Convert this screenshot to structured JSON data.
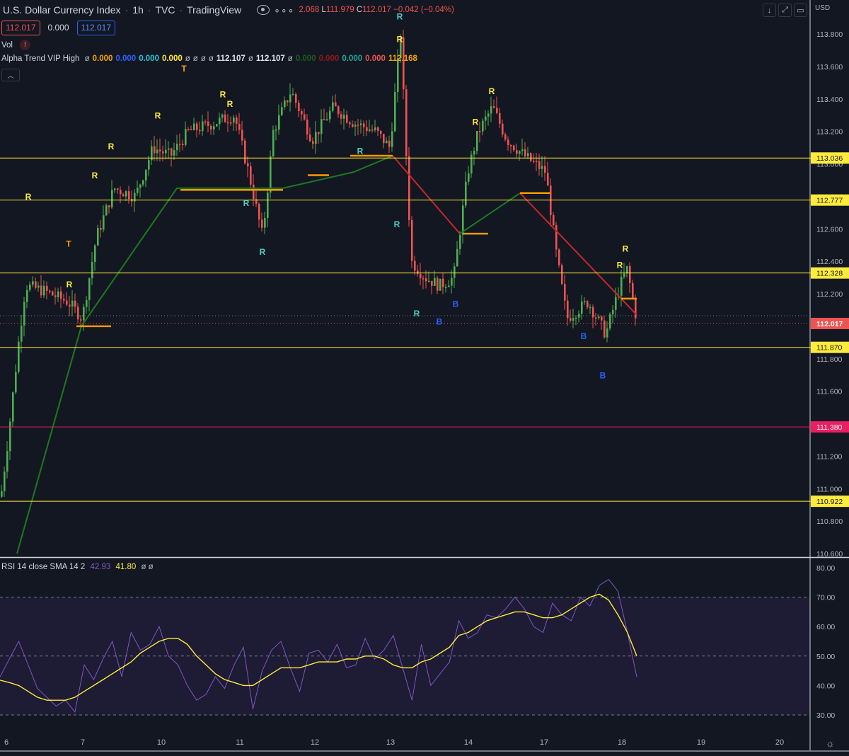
{
  "header": {
    "symbol": "U.S. Dollar Currency Index",
    "interval": "1h",
    "exchange": "TVC",
    "source": "TradingView",
    "more_icon": "more-icon",
    "ohlc": {
      "h_frag": "2.068",
      "l_label": "L",
      "l_value": "111.979",
      "c_label": "C",
      "c_value": "112.017",
      "change": "−0.042 (−0.04%)"
    }
  },
  "price_boxes": {
    "bid": "112.017",
    "spread": "0.000",
    "ask": "112.017"
  },
  "volume_label": "Vol",
  "alpha_trend": {
    "name": "Alpha Trend VIP High",
    "values": [
      {
        "t": "ø",
        "c": "#b2b5be"
      },
      {
        "t": "0.000",
        "c": "#f7a600"
      },
      {
        "t": "0.000",
        "c": "#2962ff"
      },
      {
        "t": "0.000",
        "c": "#26c6da"
      },
      {
        "t": "0.000",
        "c": "#ffeb3b"
      },
      {
        "t": "ø",
        "c": "#b2b5be"
      },
      {
        "t": "ø",
        "c": "#b2b5be"
      },
      {
        "t": "ø",
        "c": "#b2b5be"
      },
      {
        "t": "ø",
        "c": "#b2b5be"
      },
      {
        "t": "112.107",
        "c": "#e0e3eb"
      },
      {
        "t": "ø",
        "c": "#b2b5be"
      },
      {
        "t": "112.107",
        "c": "#e0e3eb"
      },
      {
        "t": "ø",
        "c": "#b2b5be"
      },
      {
        "t": "0.000",
        "c": "#1b5e20"
      },
      {
        "t": "0.000",
        "c": "#8b1a1a"
      },
      {
        "t": "0.000",
        "c": "#26a69a"
      },
      {
        "t": "0.000",
        "c": "#ef5350"
      },
      {
        "t": "112.168",
        "c": "#f7a600"
      }
    ]
  },
  "rsi": {
    "label": "RSI 14 close SMA 14 2",
    "rsi_value": "42.93",
    "sma_value": "41.80",
    "extra": "ø ø"
  },
  "price_axis": {
    "currency": "USD",
    "ticks": [
      "113.800",
      "113.600",
      "113.400",
      "113.200",
      "113.000",
      "112.800",
      "112.600",
      "112.400",
      "112.200",
      "112.000",
      "111.800",
      "111.600",
      "111.400",
      "111.200",
      "111.000",
      "110.800",
      "110.600"
    ],
    "hidden_ticks": [
      "113.000",
      "112.800",
      "111.400"
    ],
    "levels": [
      {
        "label": "113.036",
        "price": 113.036,
        "color": "#ffeb3b"
      },
      {
        "label": "112.777",
        "price": 112.777,
        "color": "#ffeb3b"
      },
      {
        "label": "112.328",
        "price": 112.328,
        "color": "#ffeb3b"
      },
      {
        "label": "111.870",
        "price": 111.87,
        "color": "#ffeb3b"
      },
      {
        "label": "111.380",
        "price": 111.38,
        "color": "#e91e63"
      },
      {
        "label": "110.922",
        "price": 110.922,
        "color": "#ffeb3b"
      }
    ],
    "current": {
      "label": "112.017",
      "price": 112.017,
      "color": "#ef5350"
    }
  },
  "rsi_axis": {
    "ticks": [
      "80.00",
      "70.00",
      "60.00",
      "50.00",
      "40.00",
      "30.00"
    ],
    "bands": [
      70,
      50,
      30
    ]
  },
  "time_axis": {
    "labels": [
      "6",
      "7",
      "10",
      "11",
      "12",
      "13",
      "14",
      "17",
      "18",
      "19",
      "20"
    ]
  },
  "signals": [
    {
      "t": "R",
      "c": "#ffeb3b",
      "p": 113.75
    },
    {
      "t": "T",
      "c": "#f7a600",
      "p": 113.57
    },
    {
      "t": "R",
      "c": "#ffeb3b",
      "p": 113.41
    },
    {
      "t": "R",
      "c": "#ffeb3b",
      "p": 113.35
    },
    {
      "t": "R",
      "c": "#ffeb3b",
      "p": 113.28
    },
    {
      "t": "R",
      "c": "#ffeb3b",
      "p": 113.09
    },
    {
      "t": "R",
      "c": "#ffeb3b",
      "p": 112.91
    },
    {
      "t": "R",
      "c": "#ffeb3b",
      "p": 112.78
    },
    {
      "t": "T",
      "c": "#f7a600",
      "p": 112.49
    },
    {
      "t": "R",
      "c": "#ffeb3b",
      "p": 112.24
    },
    {
      "t": "R",
      "c": "#4dd0c7",
      "p": 112.74
    },
    {
      "t": "R",
      "c": "#4dd0c7",
      "p": 112.44
    },
    {
      "t": "R",
      "c": "#4dd0c7",
      "p": 113.06
    },
    {
      "t": "R",
      "c": "#4dd0c7",
      "p": 113.89
    },
    {
      "t": "R",
      "c": "#4dd0c7",
      "p": 112.61
    },
    {
      "t": "R",
      "c": "#4dd0c7",
      "p": 112.06
    },
    {
      "t": "B",
      "c": "#2962ff",
      "p": 112.01
    },
    {
      "t": "B",
      "c": "#2962ff",
      "p": 112.12
    },
    {
      "t": "R",
      "c": "#ffeb3b",
      "p": 113.43
    },
    {
      "t": "R",
      "c": "#ffeb3b",
      "p": 113.24
    },
    {
      "t": "B",
      "c": "#2962ff",
      "p": 111.92
    },
    {
      "t": "B",
      "c": "#2962ff",
      "p": 111.68
    },
    {
      "t": "R",
      "c": "#ffeb3b",
      "p": 112.46
    },
    {
      "t": "R",
      "c": "#ffeb3b",
      "p": 112.36
    }
  ],
  "chart_data": {
    "type": "line",
    "price_range": [
      110.6,
      113.9
    ],
    "rsi_range": [
      27,
      82
    ],
    "trend_line": {
      "x": [
        "6",
        "7",
        "10",
        "11",
        "12",
        "13",
        "14",
        "17",
        "18"
      ],
      "values": [
        110.6,
        112.0,
        112.85,
        112.85,
        112.95,
        113.05,
        112.57,
        112.82,
        112.07
      ]
    },
    "rsi_series": [
      {
        "name": "RSI",
        "color": "#7e57c2",
        "values": [
          42.9,
          58,
          72,
          76,
          74,
          67,
          70,
          62,
          64,
          68,
          58,
          60,
          66,
          70,
          66,
          63,
          64,
          58,
          56,
          62,
          48,
          44,
          40,
          54,
          35,
          46,
          57,
          52,
          49,
          56,
          47,
          46,
          54,
          48,
          52,
          51,
          38,
          46,
          55,
          52,
          45,
          32,
          53,
          47,
          39,
          43,
          37,
          35,
          40,
          47,
          50,
          60,
          54,
          52,
          58,
          43,
          55,
          49,
          42,
          47,
          31,
          35,
          33,
          36,
          39,
          47,
          55,
          49,
          42.93
        ]
      },
      {
        "name": "SMA",
        "color": "#ffeb3b",
        "values": [
          50,
          58,
          64,
          69,
          71,
          70,
          68,
          66,
          64,
          63,
          63,
          64,
          65,
          65,
          64,
          63,
          62,
          60,
          58,
          57,
          53,
          51,
          49,
          48,
          46,
          46,
          47,
          49,
          50,
          50,
          49,
          49,
          48,
          48,
          48,
          47,
          46,
          46,
          46,
          44,
          42,
          40,
          40,
          41,
          42,
          44,
          47,
          50,
          54,
          56,
          56,
          55,
          53,
          51,
          48,
          46,
          44,
          42,
          40,
          38,
          36,
          35,
          35,
          35,
          36,
          38,
          40,
          41,
          41.8
        ]
      }
    ]
  }
}
